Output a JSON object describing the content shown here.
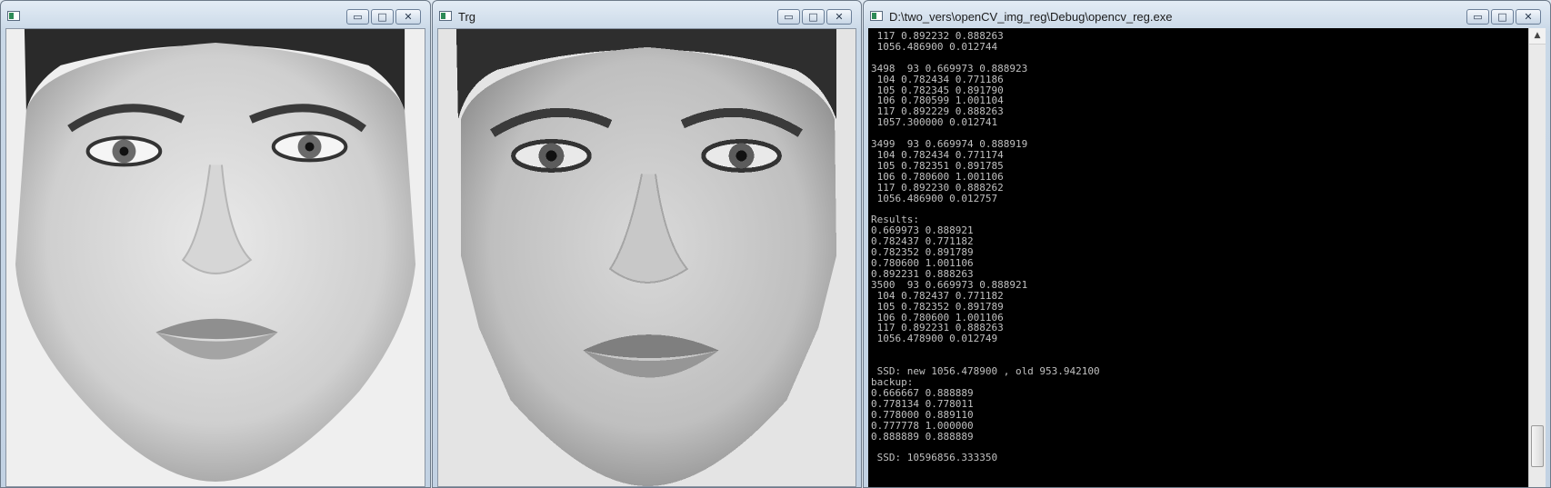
{
  "window_src": {
    "title": "",
    "buttons": {
      "minimize": "▭",
      "maximize": "□",
      "close": "✕"
    },
    "image_icon": "grayscale-face-photo"
  },
  "window_trg": {
    "title": "Trg",
    "buttons": {
      "minimize": "▭",
      "maximize": "□",
      "close": "✕"
    },
    "image_icon": "pixelated-grayscale-face-photo"
  },
  "window_console": {
    "title": "D:\\two_vers\\openCV_img_reg\\Debug\\opencv_reg.exe",
    "buttons": {
      "minimize": "▭",
      "maximize": "□",
      "close": "✕"
    },
    "lines": [
      " 117 0.892232 0.888263",
      " 1056.486900 0.012744",
      "",
      "3498  93 0.669973 0.888923",
      " 104 0.782434 0.771186",
      " 105 0.782345 0.891790",
      " 106 0.780599 1.001104",
      " 117 0.892229 0.888263",
      " 1057.300000 0.012741",
      "",
      "3499  93 0.669974 0.888919",
      " 104 0.782434 0.771174",
      " 105 0.782351 0.891785",
      " 106 0.780600 1.001106",
      " 117 0.892230 0.888262",
      " 1056.486900 0.012757",
      "",
      "Results:",
      "0.669973 0.888921",
      "0.782437 0.771182",
      "0.782352 0.891789",
      "0.780600 1.001106",
      "0.892231 0.888263",
      "3500  93 0.669973 0.888921",
      " 104 0.782437 0.771182",
      " 105 0.782352 0.891789",
      " 106 0.780600 1.001106",
      " 117 0.892231 0.888263",
      " 1056.478900 0.012749",
      "",
      "",
      " SSD: new 1056.478900 , old 953.942100",
      "backup:",
      "0.666667 0.888889",
      "0.778134 0.778011",
      "0.778000 0.889110",
      "0.777778 1.000000",
      "0.888889 0.888889",
      "",
      " SSD: 10596856.333350"
    ]
  }
}
